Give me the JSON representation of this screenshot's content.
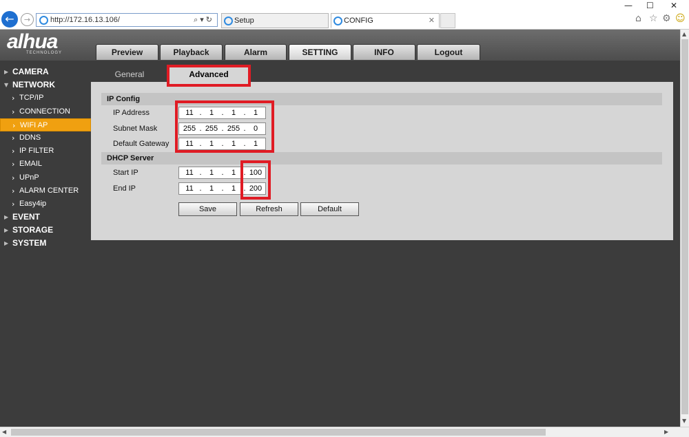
{
  "browser": {
    "url": "http://172.16.13.106/",
    "tabs": [
      {
        "title": "Setup",
        "active": false
      },
      {
        "title": "CONFIG",
        "active": true
      }
    ]
  },
  "app": {
    "logo_text": "alhua",
    "logo_subtext": "TECHNOLOGY",
    "main_tabs": [
      {
        "label": "Preview"
      },
      {
        "label": "Playback"
      },
      {
        "label": "Alarm"
      },
      {
        "label": "SETTING",
        "active": true
      },
      {
        "label": "INFO"
      },
      {
        "label": "Logout"
      }
    ]
  },
  "sidebar": {
    "items": [
      {
        "label": "CAMERA"
      },
      {
        "label": "NETWORK",
        "expanded": true
      },
      {
        "label": "TCP/IP"
      },
      {
        "label": "CONNECTION"
      },
      {
        "label": "WIFI AP",
        "selected": true
      },
      {
        "label": "DDNS"
      },
      {
        "label": "IP FILTER"
      },
      {
        "label": "EMAIL"
      },
      {
        "label": "UPnP"
      },
      {
        "label": "ALARM CENTER"
      },
      {
        "label": "Easy4ip"
      },
      {
        "label": "EVENT"
      },
      {
        "label": "STORAGE"
      },
      {
        "label": "SYSTEM"
      }
    ]
  },
  "subtabs": [
    {
      "label": "General"
    },
    {
      "label": "Advanced",
      "active": true
    }
  ],
  "ip_config": {
    "header": "IP Config",
    "ip_address": {
      "label": "IP Address",
      "octets": [
        "11",
        "1",
        "1",
        "1"
      ]
    },
    "subnet_mask": {
      "label": "Subnet Mask",
      "octets": [
        "255",
        "255",
        "255",
        "0"
      ]
    },
    "default_gateway": {
      "label": "Default Gateway",
      "octets": [
        "11",
        "1",
        "1",
        "1"
      ]
    }
  },
  "dhcp_server": {
    "header": "DHCP Server",
    "start_ip": {
      "label": "Start IP",
      "octets": [
        "11",
        "1",
        "1",
        "100"
      ]
    },
    "end_ip": {
      "label": "End IP",
      "octets": [
        "11",
        "1",
        "1",
        "200"
      ]
    }
  },
  "buttons": {
    "save": "Save",
    "refresh": "Refresh",
    "default": "Default"
  },
  "colors": {
    "highlight_red": "#e01b24",
    "nav_selected": "#f0a010",
    "background": "#3c3c3c",
    "panel": "#d6d6d6"
  }
}
